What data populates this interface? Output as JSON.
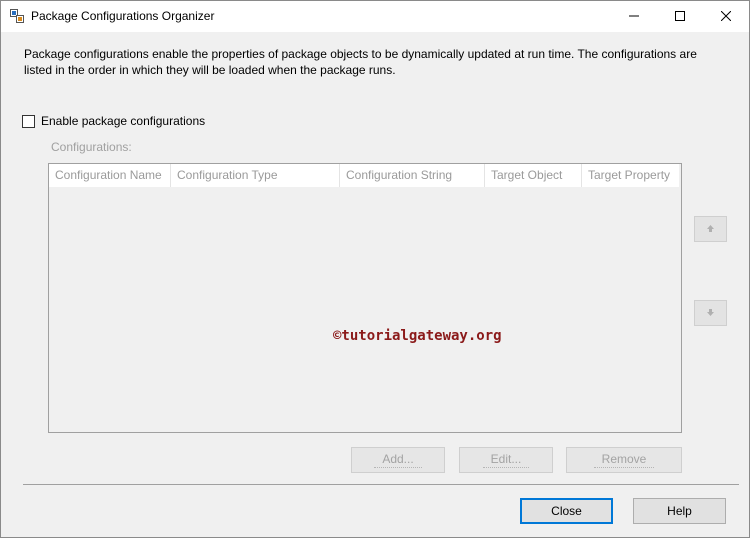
{
  "window": {
    "title": "Package Configurations Organizer",
    "icon": "ssis-package-icon",
    "controls": {
      "minimize": "minimize-icon",
      "maximize": "maximize-icon",
      "close": "close-icon"
    }
  },
  "description": "Package configurations enable the properties of package objects to be dynamically updated at run time. The configurations are listed in the order in which they will be loaded when the package runs.",
  "enable": {
    "label": "Enable package configurations",
    "checked": false
  },
  "configurations": {
    "label": "Configurations:",
    "columns": [
      "Configuration Name",
      "Configuration Type",
      "Configuration String",
      "Target Object",
      "Target Property"
    ],
    "rows": []
  },
  "watermark": "©tutorialgateway.org",
  "side_buttons": {
    "move_up_icon": "arrow-up-icon",
    "move_down_icon": "arrow-down-icon"
  },
  "actions": {
    "add": "Add...",
    "edit": "Edit...",
    "remove": "Remove"
  },
  "dialog_buttons": {
    "close": "Close",
    "help": "Help"
  },
  "colors": {
    "accent": "#0078d7",
    "disabled_text": "#a0a0a0",
    "watermark": "#8b1a1a"
  }
}
